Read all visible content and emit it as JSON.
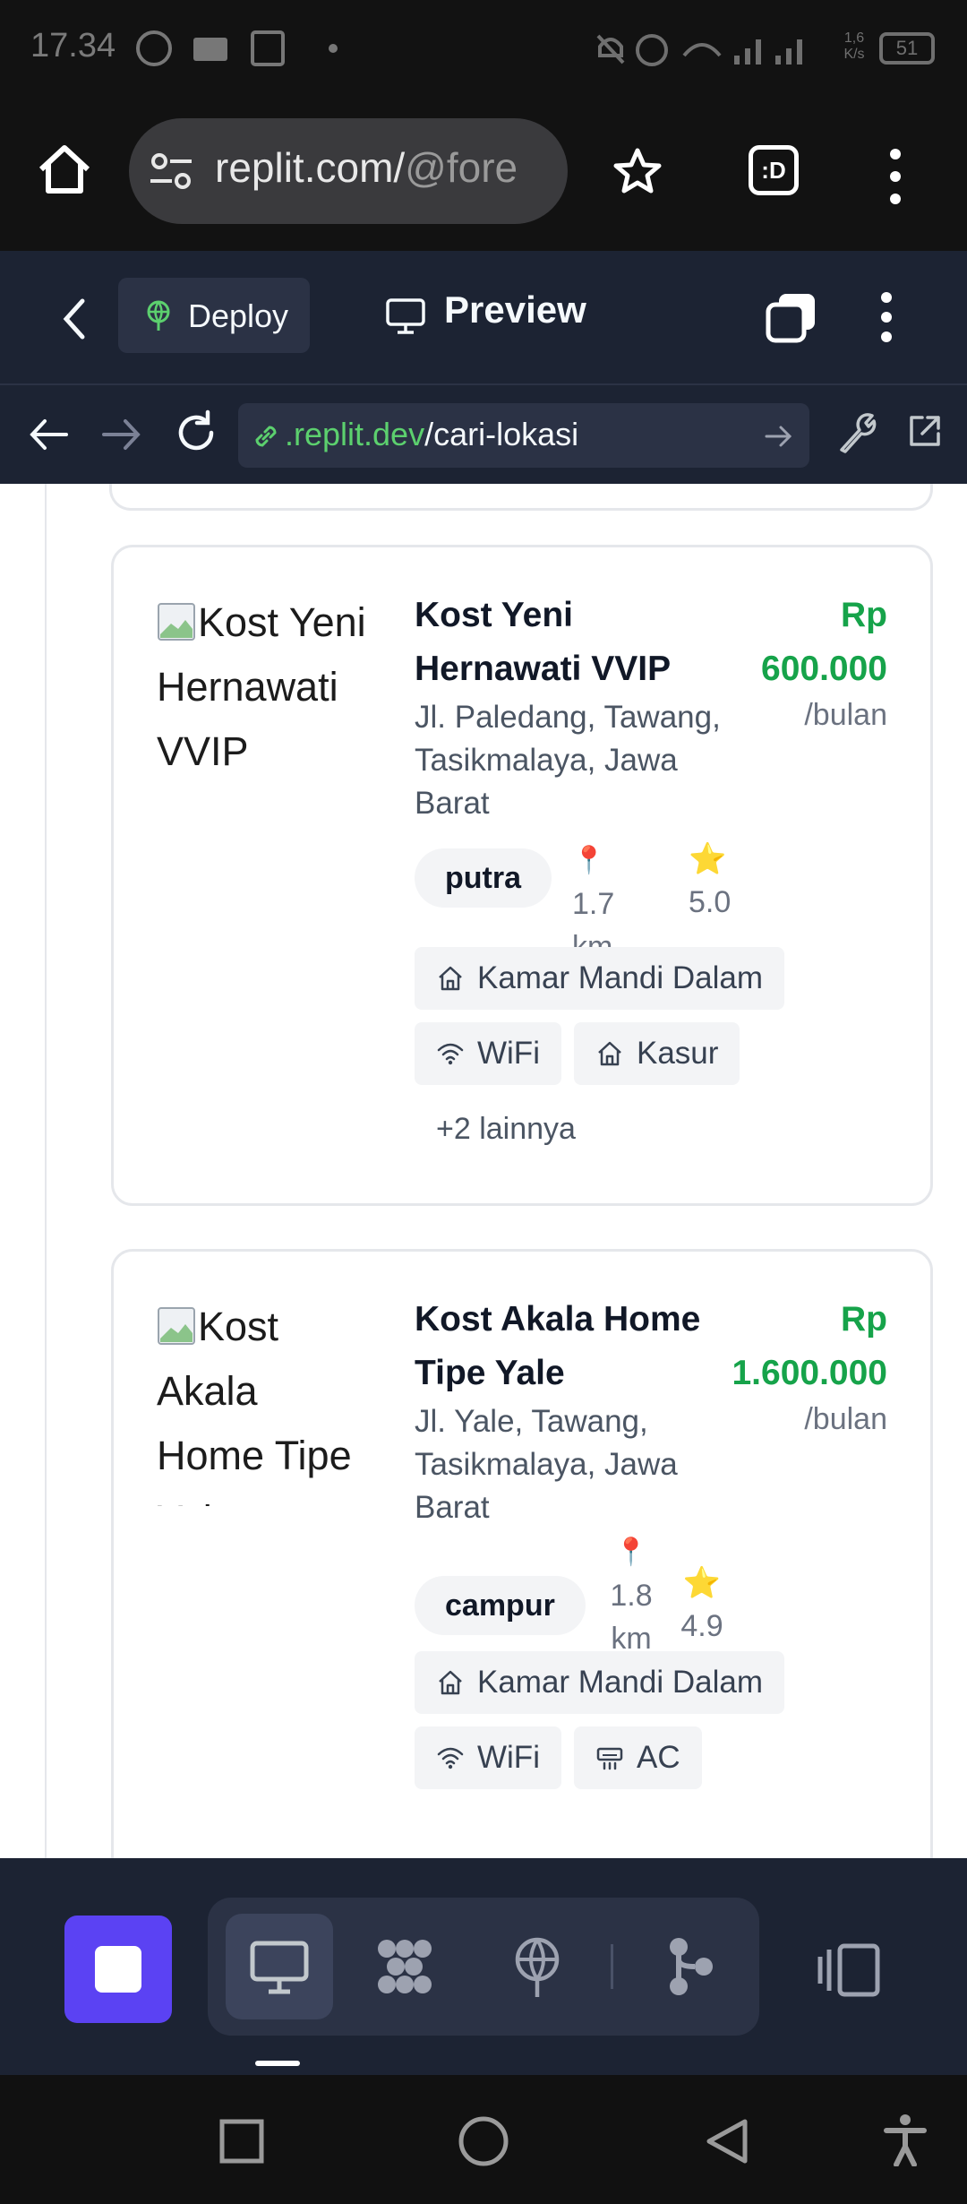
{
  "status_bar": {
    "time": "17.34",
    "net_speed": "1,6 K/s",
    "battery": "51"
  },
  "browser": {
    "url_host": "replit.com/",
    "url_rest": "@fore",
    "tabs_label": ":D"
  },
  "replit_header": {
    "deploy_label": "Deploy",
    "preview_label": "Preview"
  },
  "webview": {
    "address_host": ".replit.dev",
    "address_path": "/cari-lokasi"
  },
  "listings": [
    {
      "image_alt": "Kost Yeni Hernawati VVIP",
      "title": "Kost Yeni Hernawati VVIP",
      "price_prefix": "Rp",
      "price": "600.000",
      "period": "/bulan",
      "address": "Jl. Paledang, Tawang, Tasikmalaya, Jawa Barat",
      "type": "putra",
      "distance_num": "1.7",
      "distance_unit": "km",
      "rating": "5.0",
      "facilities": [
        "Kamar Mandi Dalam",
        "WiFi",
        "Kasur"
      ],
      "more": "+2 lainnya"
    },
    {
      "image_alt": "Kost Akala Home Tipe Yale",
      "title": "Kost Akala Home Tipe Yale",
      "price_prefix": "Rp",
      "price": "1.600.000",
      "period": "/bulan",
      "address": "Jl. Yale, Tawang, Tasikmalaya, Jawa Barat",
      "type": "campur",
      "distance_num": "1.8",
      "distance_unit": "km",
      "rating": "4.9",
      "facilities": [
        "Kamar Mandi Dalam",
        "WiFi",
        "AC"
      ]
    }
  ],
  "icons": {
    "pin": "📍",
    "star": "⭐"
  },
  "colors": {
    "price_green": "#16a34a",
    "replit_bg": "#1c2333",
    "stop_purple": "#5b42f3"
  }
}
